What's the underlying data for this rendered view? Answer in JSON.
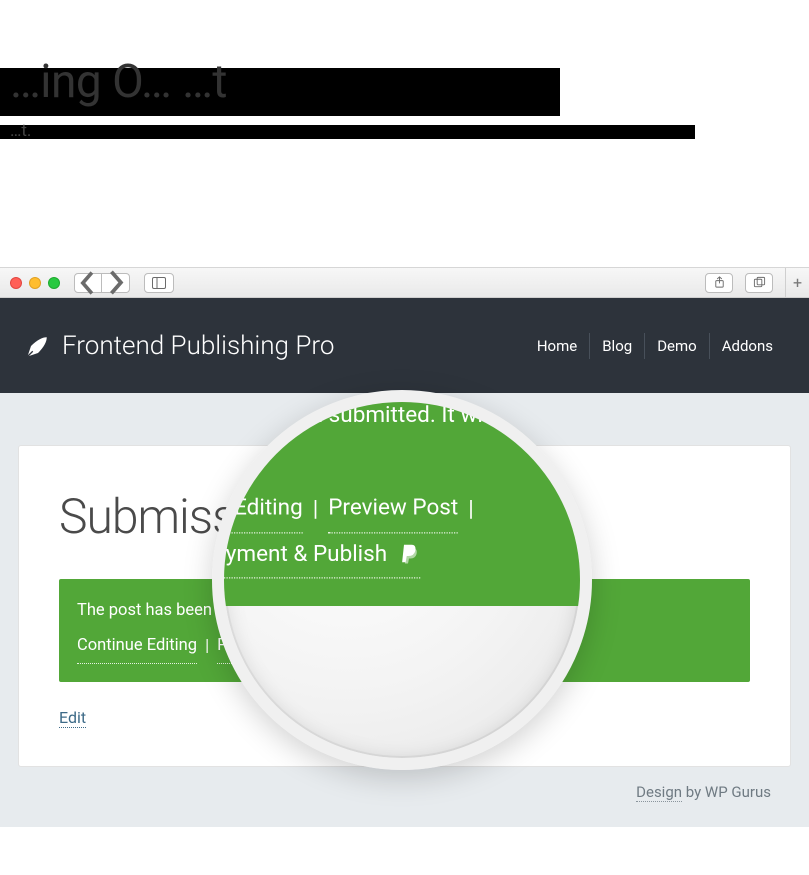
{
  "hero": {
    "title": "…ing O… …t",
    "subtitle": "…t."
  },
  "browser": {
    "plus": "+"
  },
  "site": {
    "brand": "Frontend Publishing Pro",
    "menu": [
      "Home",
      "Blog",
      "Demo",
      "Addons"
    ]
  },
  "page": {
    "title": "Submission Form",
    "notice_msg": "The post has been submitted. It will be reviewed by an editor soon.",
    "link_continue": "Continue Editing",
    "link_preview": "Preview Post",
    "link_pay": "Make Payment & Publish",
    "sep": " | ",
    "edit": "Edit"
  },
  "footer": {
    "design": "Design",
    "by": " by WP Gurus"
  }
}
